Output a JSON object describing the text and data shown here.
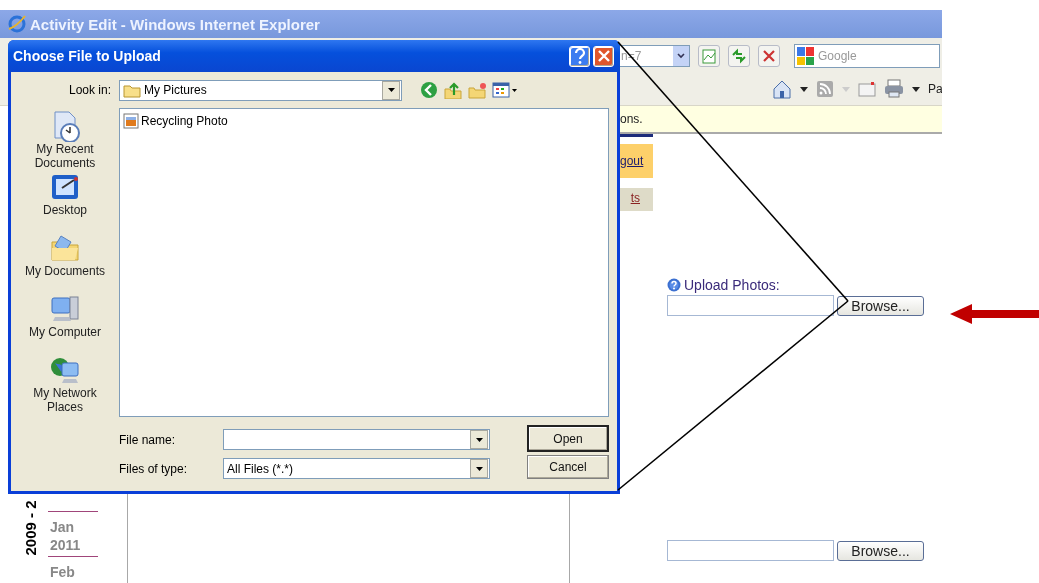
{
  "browser": {
    "title": "Activity Edit - Windows Internet Explorer",
    "address": "n=7",
    "search_placeholder": "Google",
    "toolbar_label": "Pa",
    "info_bar": "ons."
  },
  "page": {
    "nav_links": [
      {
        "label": "gout",
        "kind": "primary"
      },
      {
        "label": "ts",
        "kind": "secondary"
      }
    ],
    "date_strip": {
      "year_range": "2009 - 2",
      "months": [
        "Jan 2011",
        "Feb"
      ]
    },
    "upload": {
      "label": "Upload Photos:",
      "fields": [
        {
          "button": "Browse..."
        },
        {
          "button": "Browse..."
        }
      ]
    }
  },
  "dialog": {
    "title": "Choose File to Upload",
    "look_in_label": "Look in:",
    "look_in_value": "My Pictures",
    "places": [
      {
        "label": "My Recent Documents",
        "kind": "recent"
      },
      {
        "label": "Desktop",
        "kind": "desktop"
      },
      {
        "label": "My Documents",
        "kind": "documents"
      },
      {
        "label": "My Computer",
        "kind": "computer"
      },
      {
        "label": "My Network Places",
        "kind": "network"
      }
    ],
    "files": [
      {
        "name": "Recycling Photo"
      }
    ],
    "file_name_label": "File name:",
    "file_type_label": "Files of type:",
    "file_type_value": "All Files (*.*)",
    "buttons": [
      "Open",
      "Cancel"
    ]
  }
}
